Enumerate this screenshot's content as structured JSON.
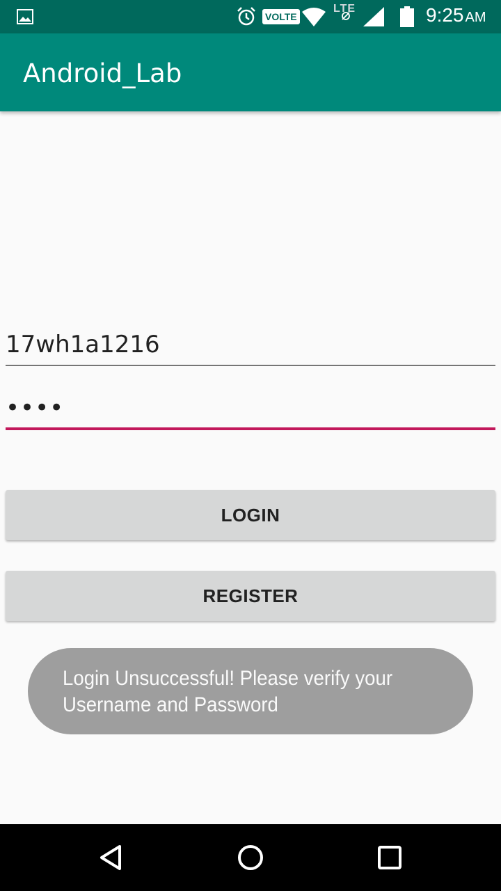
{
  "status_bar": {
    "icons": [
      "gallery-icon",
      "alarm-icon",
      "volte-badge",
      "wifi-icon",
      "lte-icon",
      "signal-icon",
      "battery-icon"
    ],
    "volte": "VOLTE",
    "lte": "LTE",
    "time": "9:25",
    "ampm": "AM",
    "color": "#00695c"
  },
  "app_bar": {
    "title": "Android_Lab",
    "color": "#00897b"
  },
  "form": {
    "username_value": "17wh1a1216",
    "password_value": "••••",
    "login_label": "LOGIN",
    "register_label": "REGISTER",
    "accent_color": "#c2185b"
  },
  "toast": {
    "line1": "Login Unsuccessful! Please verify your",
    "line2": "Username and Password"
  },
  "nav_bar": {
    "icons": [
      "back-icon",
      "home-icon",
      "recent-apps-icon"
    ]
  }
}
